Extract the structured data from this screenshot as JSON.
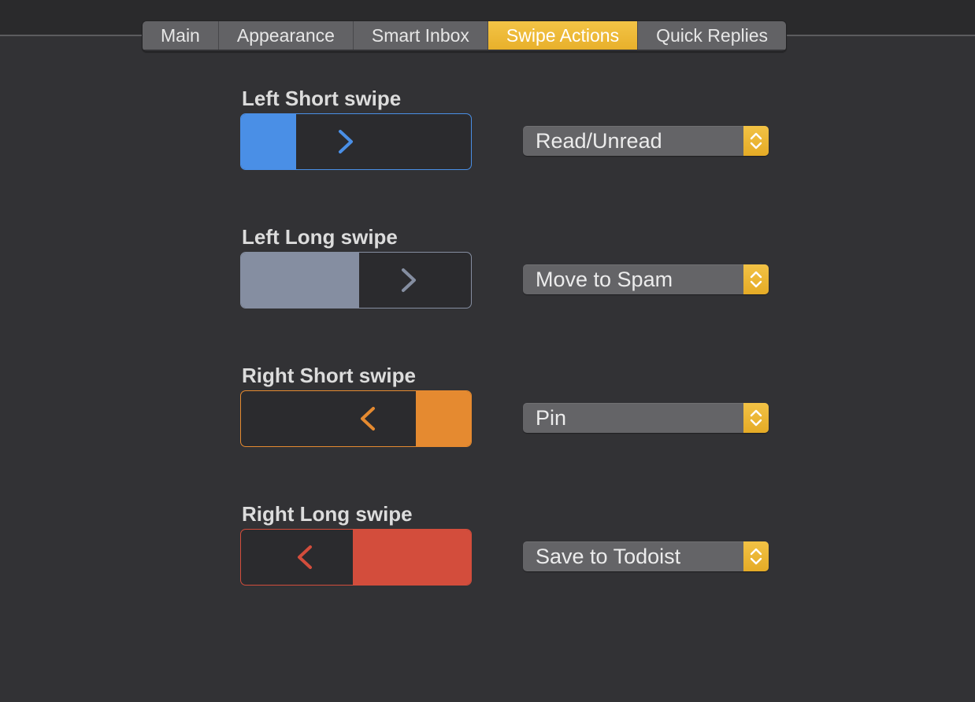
{
  "tabs": [
    {
      "label": "Main",
      "active": false
    },
    {
      "label": "Appearance",
      "active": false
    },
    {
      "label": "Smart Inbox",
      "active": false
    },
    {
      "label": "Swipe Actions",
      "active": true
    },
    {
      "label": "Quick Replies",
      "active": false
    }
  ],
  "colors": {
    "accent": "#ecb636",
    "left_short": "#4a8fe6",
    "left_long": "#858ea1",
    "right_short": "#e58a30",
    "right_long": "#d34d3c"
  },
  "swipes": [
    {
      "label": "Left Short swipe",
      "action": "Read/Unread",
      "direction": "right-arrow-icon"
    },
    {
      "label": "Left Long swipe",
      "action": "Move to Spam",
      "direction": "right-arrow-icon"
    },
    {
      "label": "Right Short swipe",
      "action": "Pin",
      "direction": "left-arrow-icon"
    },
    {
      "label": "Right Long swipe",
      "action": "Save to Todoist",
      "direction": "left-arrow-icon"
    }
  ]
}
